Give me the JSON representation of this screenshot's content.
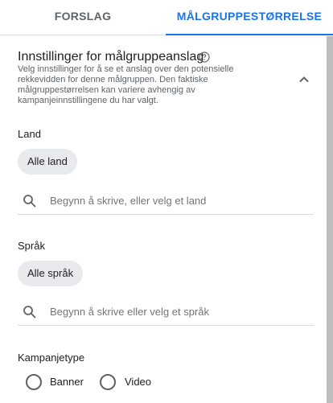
{
  "tabs": [
    {
      "label": "FORSLAG",
      "active": false
    },
    {
      "label": "MÅLGRUPPESTØRRELSE",
      "active": true
    }
  ],
  "section": {
    "title": "Innstillinger for målgruppeanslag",
    "description": "Velg innstillinger for å se et anslag over den potensielle rekkevidden for denne målgruppen. Den faktiske målgruppestørrelsen kan variere avhengig av kampanjeinnstillingene du har valgt.",
    "help_icon": "help-circle-icon",
    "collapse_icon": "chevron-up-icon"
  },
  "land": {
    "label": "Land",
    "chip": "Alle land",
    "search_placeholder": "Begynn å skrive, eller velg et land"
  },
  "sprak": {
    "label": "Språk",
    "chip": "Alle språk",
    "search_placeholder": "Begynn å skrive eller velg et språk"
  },
  "kampanjetype": {
    "label": "Kampanjetype",
    "options": [
      "Banner",
      "Video"
    ]
  },
  "colors": {
    "accent": "#1a73e8",
    "chip_bg": "#e8eaed",
    "scrollbar": "#bdbdbd"
  }
}
